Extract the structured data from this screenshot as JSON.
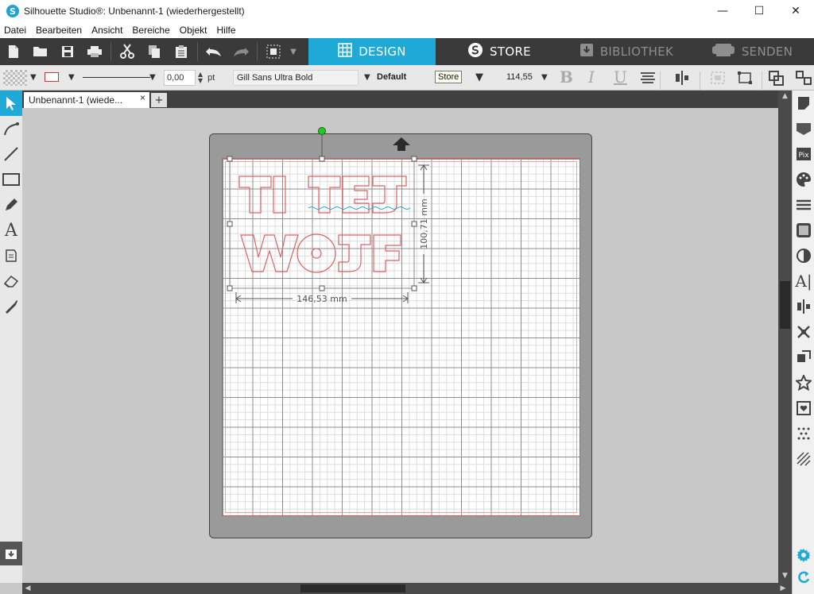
{
  "window": {
    "title": "Silhouette Studio®: Unbenannt-1 (wiederhergestellt)",
    "logo_glyph": "S",
    "minimize": "—",
    "maximize": "☐",
    "close": "✕"
  },
  "menu": [
    "Datei",
    "Bearbeiten",
    "Ansicht",
    "Bereiche",
    "Objekt",
    "Hilfe"
  ],
  "nav_tabs": {
    "design": "DESIGN",
    "store": "STORE",
    "library": "BIBLIOTHEK",
    "send": "SENDEN"
  },
  "properties": {
    "line_width": "0,00",
    "line_unit": "pt",
    "font_name": "Gill Sans Ultra Bold",
    "font_style": "Default",
    "tooltip": "Store",
    "font_size": "114,55",
    "bold": "B",
    "italic": "I",
    "underline": "U"
  },
  "document": {
    "tab_label": "Unbenannt-1 (wiede...",
    "tab_close": "×",
    "tab_add": "+"
  },
  "design": {
    "text_line_1": "TI TEJ",
    "text_line_2": "WOJF",
    "width_label": "146,53 mm",
    "height_label": "100,71 mm"
  },
  "colors": {
    "accent": "#1ea9d6",
    "cut_line": "#e06060",
    "rotation_handle": "#22cc22"
  }
}
